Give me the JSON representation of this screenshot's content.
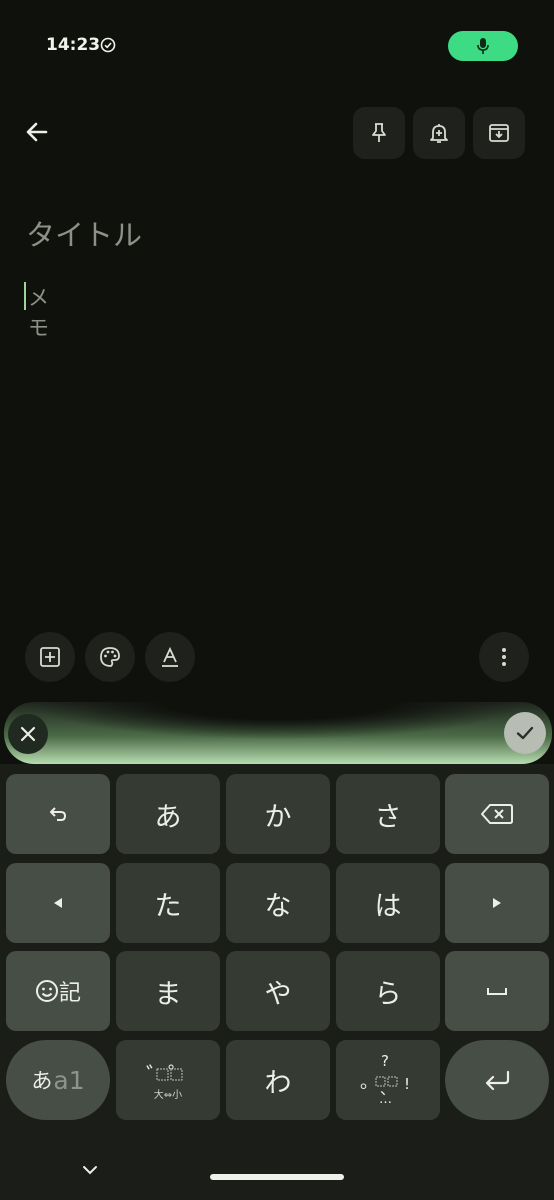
{
  "status_bar": {
    "time": "14:23"
  },
  "editor": {
    "title_placeholder": "タイトル",
    "memo_placeholder": "メモ"
  },
  "keyboard": {
    "rows": [
      [
        "undo-icon",
        "あ",
        "か",
        "さ",
        "backspace-icon"
      ],
      [
        "left-arrow-icon",
        "た",
        "な",
        "は",
        "right-arrow-icon"
      ],
      [
        "emoji-symbol",
        "ま",
        "や",
        "ら",
        "space-icon"
      ],
      [
        "mode-switch",
        "dakuten",
        "わ",
        "punctuation",
        "enter-icon"
      ]
    ],
    "emoji_key_label": "記",
    "mode_key": {
      "kana": "あ",
      "alpha": "a1"
    },
    "dakuten_key": {
      "marks": "゛゜",
      "sub": "大⇔小"
    },
    "punct_key": {
      "question": "?",
      "period": "。",
      "comma": "、",
      "exclaim": "!",
      "ellipsis": "…"
    }
  },
  "colors": {
    "accent": "#3ddc84",
    "background": "#0f110d",
    "key": "#353a33",
    "function_key": "#474e45"
  }
}
